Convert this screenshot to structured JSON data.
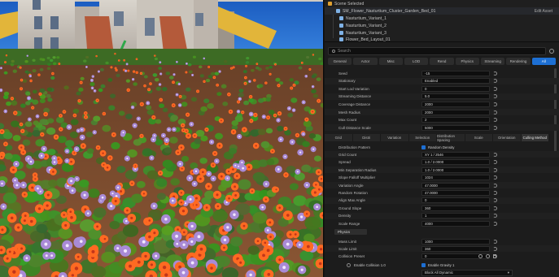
{
  "outliner": {
    "rows": [
      {
        "label": "Scene Selected",
        "icon_color": "#e0a030"
      },
      {
        "label": "SM_Flower_Nasturtium_Cluster_Garden_Bed_01",
        "icon_color": "#7fb2e6",
        "right": "Edit Asset"
      },
      {
        "label": "Nasturtium_Variant_1",
        "icon_color": "#7fb2e6"
      },
      {
        "label": "Nasturtium_Variant_2",
        "icon_color": "#7fb2e6"
      },
      {
        "label": "Nasturtium_Variant_3",
        "icon_color": "#7fb2e6"
      },
      {
        "label": "Flower_Bed_Layout_01",
        "icon_color": "#7fb2e6"
      }
    ]
  },
  "search": {
    "placeholder": "Search"
  },
  "filter_tabs": [
    "General",
    "Actor",
    "Misc",
    "LOD",
    "Rend",
    "Physics",
    "Streaming",
    "Rendering",
    "All"
  ],
  "top_props": [
    {
      "label": "Seed",
      "value": "-15"
    },
    {
      "label": "Stationary",
      "value": "Enabled"
    },
    {
      "label": "Start Lod Variation",
      "value": "0"
    },
    {
      "label": "Streaming Distance",
      "value": "5.0"
    },
    {
      "label": "Coverage Distance",
      "value": "2000"
    },
    {
      "label": "Mesh Radius",
      "value": "2000"
    },
    {
      "label": "Max Count",
      "value": "2"
    },
    {
      "label": "Cull Distance Scale",
      "value": "5000"
    }
  ],
  "sub_tabs": [
    "Grid",
    "Distri",
    "Variation",
    "Selection",
    "Distribution Spacing",
    "Scale",
    "Orientation",
    "Culling Method"
  ],
  "mid_props": [
    {
      "label": "Distribution Pattern",
      "type": "check",
      "value": "Random Density"
    },
    {
      "label": "Grid Count",
      "value": "XY 1 / 2546"
    },
    {
      "label": "Spread",
      "value": "1.0 / 2.0000"
    },
    {
      "label": "Min Separation Radius",
      "value": "1.0 / 2.0000"
    },
    {
      "label": "Slope Falloff Multiplier",
      "value": "1024"
    },
    {
      "label": "Variation Angle",
      "value": "47.0000"
    },
    {
      "label": "Random Rotation",
      "value": "47.0000"
    },
    {
      "label": "Align Max Angle",
      "value": "0"
    },
    {
      "label": "Ground Slope",
      "value": "360"
    },
    {
      "label": "Density",
      "value": "1"
    },
    {
      "label": "Scale Range",
      "value": "4000"
    }
  ],
  "section_label": "Physics",
  "low_props": [
    {
      "label": "Mass Limit",
      "value": "1000"
    },
    {
      "label": "Scale Limit",
      "value": "360"
    },
    {
      "label": "Collision Preset",
      "value": "0"
    }
  ],
  "bottom": {
    "check_label": "Enable Collision 1.0",
    "dropdown_value": "Block All Dynamic",
    "check2_label": "Enable Gravity 1"
  },
  "viewport": {
    "sky_color": "#1e63c4",
    "soil_color": "#7a4a2c",
    "flower_orange": "#ff6a22",
    "flower_purple": "#a98ad6",
    "leaf_green": "#4f8a2a"
  }
}
